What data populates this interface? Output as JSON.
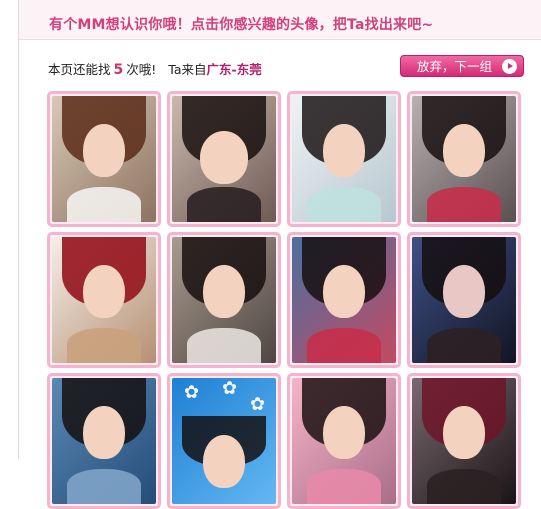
{
  "header": {
    "title": "有个MM想认识你哦！点击你感兴趣的头像，把Ta找出来吧~"
  },
  "info": {
    "prefix": "本页还能找",
    "count": "5",
    "suffix": "次哦!",
    "from_label": "Ta来自",
    "location": "广东-东莞"
  },
  "skip_button": {
    "label": "放弃，下一组"
  },
  "grid": {
    "tiles": [
      {
        "name": "avatar-tile-1"
      },
      {
        "name": "avatar-tile-2"
      },
      {
        "name": "avatar-tile-3"
      },
      {
        "name": "avatar-tile-4"
      },
      {
        "name": "avatar-tile-5"
      },
      {
        "name": "avatar-tile-6"
      },
      {
        "name": "avatar-tile-7"
      },
      {
        "name": "avatar-tile-8"
      },
      {
        "name": "avatar-tile-9"
      },
      {
        "name": "avatar-tile-10"
      },
      {
        "name": "avatar-tile-11"
      },
      {
        "name": "avatar-tile-12"
      }
    ]
  },
  "colors": {
    "accent": "#d2407d",
    "tile_border": "#f5b4cd",
    "button": "#d42b77"
  }
}
